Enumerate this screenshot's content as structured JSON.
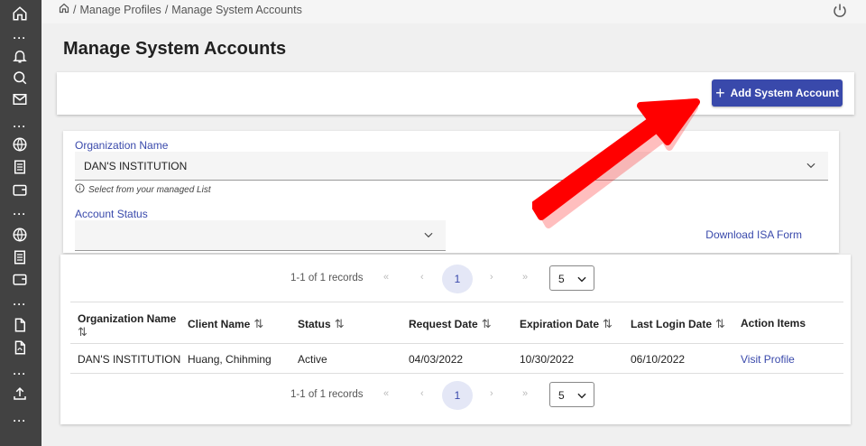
{
  "breadcrumb": {
    "items": [
      "Manage Profiles",
      "Manage System Accounts"
    ]
  },
  "page": {
    "title": "Manage System Accounts"
  },
  "actions": {
    "add_button_label": "Add System Account"
  },
  "filters": {
    "org_label": "Organization Name",
    "org_value": "DAN'S INSTITUTION",
    "org_hint": "Select from your managed List",
    "status_label": "Account Status",
    "status_value": "",
    "download_link": "Download ISA Form"
  },
  "pagination": {
    "records": "1-1 of 1 records",
    "current_page": "1",
    "page_size": "5"
  },
  "table": {
    "columns": [
      "Organization Name",
      "Client Name",
      "Status",
      "Request Date",
      "Expiration Date",
      "Last Login Date",
      "Action Items"
    ],
    "sort_glyph": "⇅",
    "rows": [
      [
        "DAN'S INSTITUTION",
        "Huang, Chihming",
        "Active",
        "04/03/2022",
        "10/30/2022",
        "06/10/2022",
        "Visit Profile"
      ]
    ]
  },
  "colors": {
    "accent": "#3949ab",
    "sidebar": "#424242",
    "annotation": "#ff0000"
  }
}
